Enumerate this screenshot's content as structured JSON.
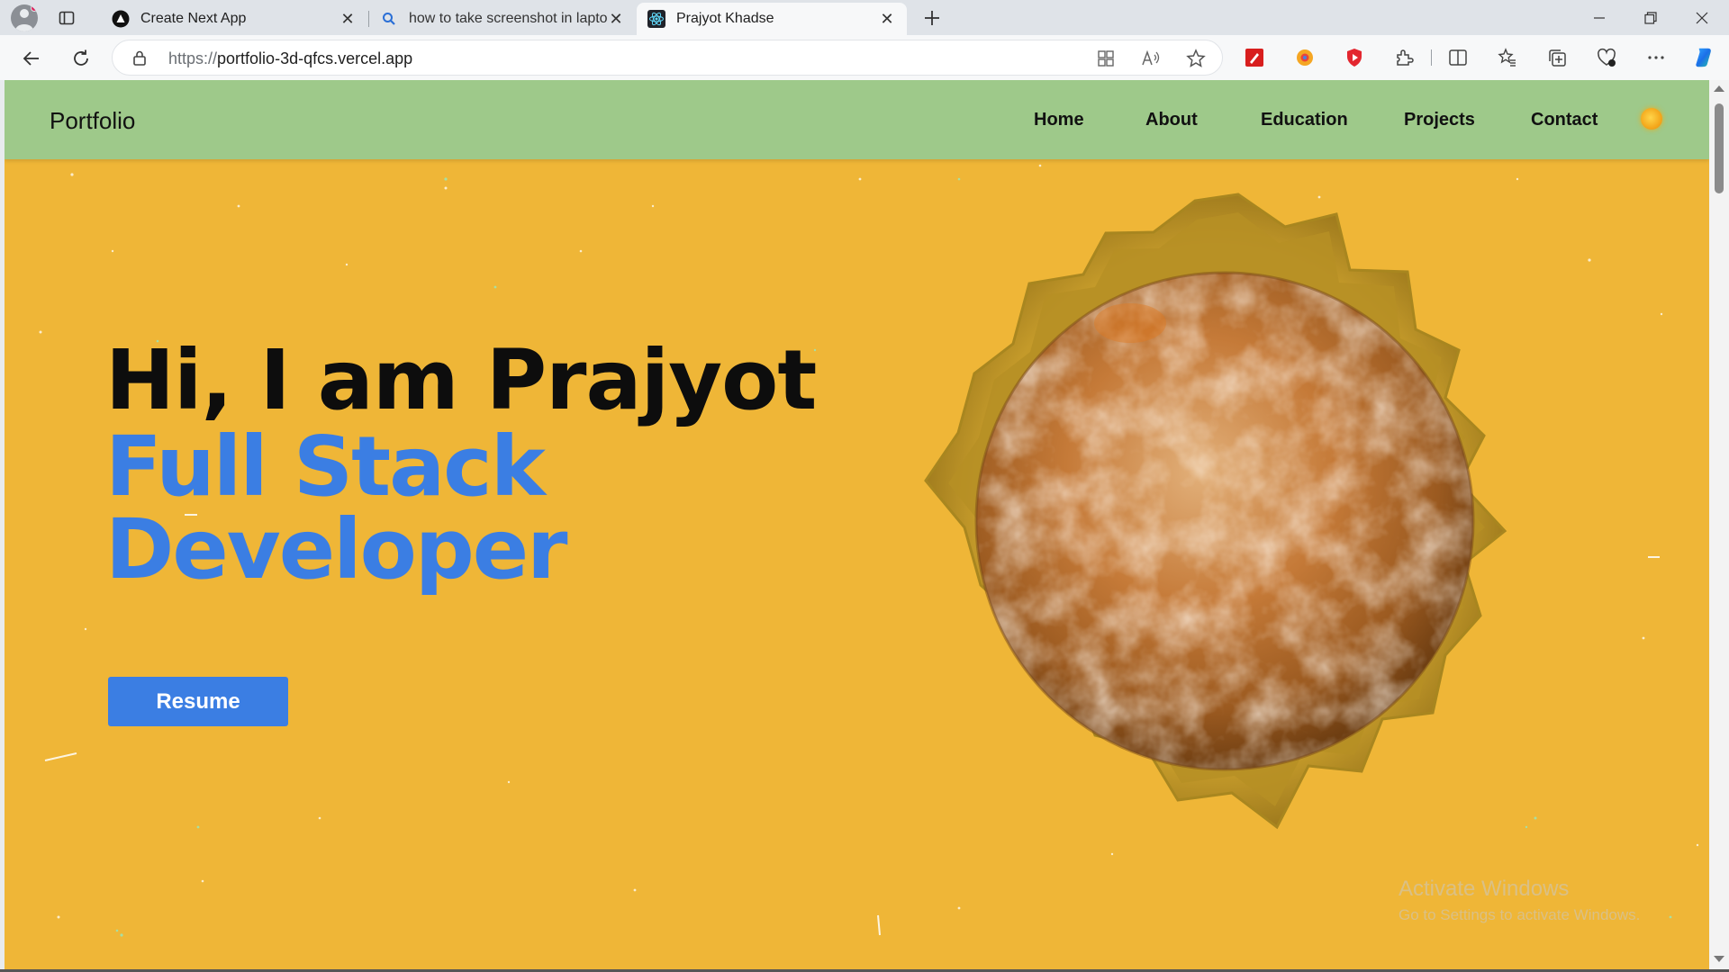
{
  "browser": {
    "tabs": [
      {
        "title": "Create Next App",
        "icon": "nextjs-icon"
      },
      {
        "title": "how to take screenshot in laptop",
        "icon": "search-icon"
      },
      {
        "title": "Prajyot Khadse",
        "icon": "react-icon"
      }
    ],
    "active_tab": 2,
    "address": {
      "protocol": "https://",
      "host": "portfolio-3d-qfcs.vercel.app"
    },
    "window_controls": {
      "minimize": "minimize-icon",
      "restore": "restore-icon",
      "close": "close-icon"
    }
  },
  "site": {
    "brand": "Portfolio",
    "nav": [
      "Home",
      "About",
      "Education",
      "Projects",
      "Contact"
    ],
    "theme_toggle": "sun-icon"
  },
  "hero": {
    "greeting": "Hi, I am Prajyot",
    "role_line1": "Full Stack",
    "role_line2": "Developer",
    "resume_button": "Resume"
  },
  "watermark": {
    "title": "Activate Windows",
    "subtitle": "Go to Settings to activate Windows."
  },
  "colors": {
    "page_background": "#efb637",
    "nav_background": "#9ec98a",
    "accent_blue": "#3b7ee3"
  }
}
